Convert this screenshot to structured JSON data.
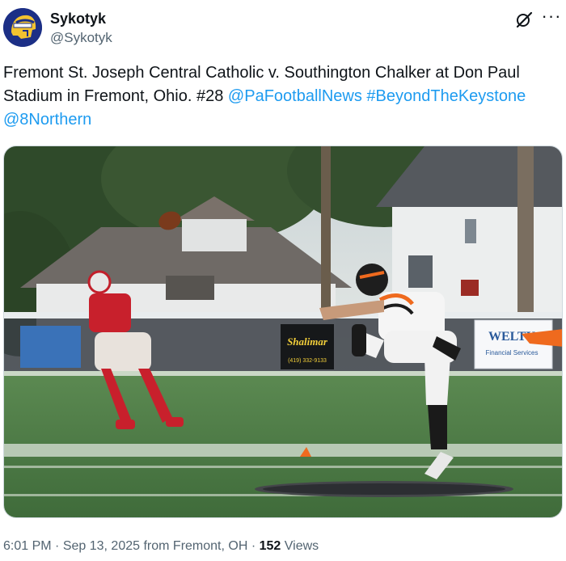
{
  "author": {
    "display_name": "Sykotyk",
    "handle": "@Sykotyk",
    "avatar_icon": "trojans-helmet-avatar"
  },
  "tweet": {
    "text_plain": "Fremont St. Joseph Central Catholic v. Southington Chalker at Don Paul Stadium in Fremont, Ohio. #28 ",
    "mentions": [
      "@PaFootballNews",
      "#BeyondTheKeystone",
      "@8Northern"
    ]
  },
  "media": {
    "alt": "Football kicker in black and orange follows through after a kick while a player in red looks on",
    "sign_text": "Shalimar",
    "sign_phone": "(419) 332-9133",
    "banner_text": "WELTY",
    "banner_sub": "Financial Services"
  },
  "footer": {
    "time": "6:01 PM",
    "date": "Sep 13, 2025",
    "location": "from Fremont, OH",
    "views": "152",
    "views_label": "Views"
  },
  "colors": {
    "link": "#1d9bf0",
    "secondary": "#536471",
    "field": "#4e7a46"
  }
}
